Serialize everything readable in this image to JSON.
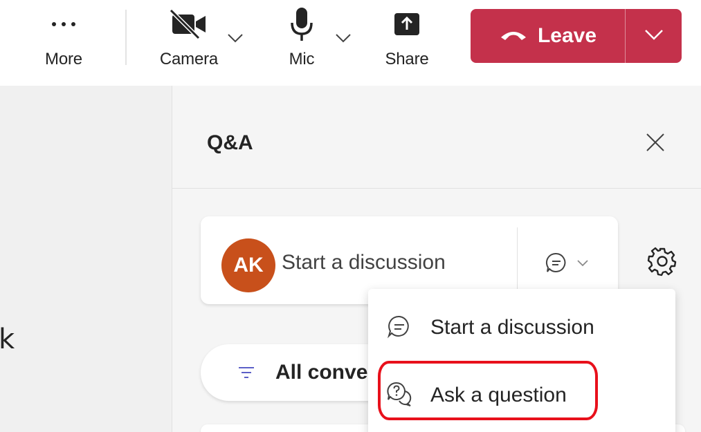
{
  "toolbar": {
    "more_label": "More",
    "camera_label": "Camera",
    "mic_label": "Mic",
    "share_label": "Share",
    "leave_label": "Leave"
  },
  "left_glyph": "k",
  "panel": {
    "title": "Q&A",
    "composer": {
      "avatar_initials": "AK",
      "placeholder": "Start a discussion"
    },
    "filter_label": "All conve"
  },
  "menu": {
    "items": [
      {
        "label": "Start a discussion",
        "icon": "chat-bubble-icon"
      },
      {
        "label": "Ask a question",
        "icon": "question-bubble-icon"
      }
    ]
  },
  "colors": {
    "leave_bg": "#c4314b",
    "avatar_bg": "#c8501b",
    "highlight": "#e8101b",
    "panel_bg": "#f5f5f5"
  }
}
